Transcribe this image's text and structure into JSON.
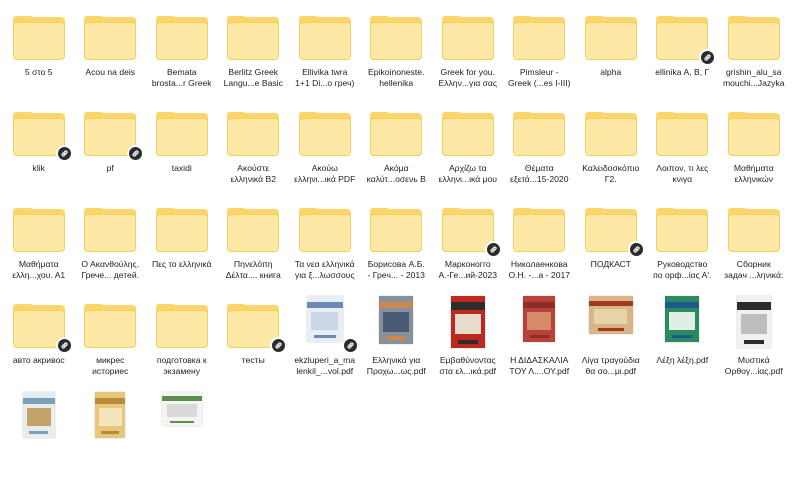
{
  "items": [
    {
      "label": "5 στο 5",
      "kind": "folder",
      "shared": false
    },
    {
      "label": "Acou na deis",
      "kind": "folder",
      "shared": false
    },
    {
      "label": "Bemata\nbrosta...r Greek",
      "kind": "folder",
      "shared": false
    },
    {
      "label": "Berlitz Greek\nLangu...e Basic",
      "kind": "folder",
      "shared": false
    },
    {
      "label": "Ellivika twra\n1+1 Di...o греч)",
      "kind": "folder",
      "shared": false
    },
    {
      "label": "Epikoinoneste.\nhellenika",
      "kind": "folder",
      "shared": false
    },
    {
      "label": "Greek for you.\nΕλλην...για σας",
      "kind": "folder",
      "shared": false
    },
    {
      "label": "Pimsleur -\nGreek (...es I-III)",
      "kind": "folder",
      "shared": false
    },
    {
      "label": "alpha",
      "kind": "folder",
      "shared": false
    },
    {
      "label": "ellinika A, B, Γ",
      "kind": "folder",
      "shared": true
    },
    {
      "label": "grishin_alu_sa\nmouchi...Jazyka",
      "kind": "folder",
      "shared": false
    },
    {
      "label": "klik",
      "kind": "folder",
      "shared": true
    },
    {
      "label": "pf",
      "kind": "folder",
      "shared": true
    },
    {
      "label": "taxidi",
      "kind": "folder",
      "shared": false
    },
    {
      "label": "Ακούστε\nελληνικά Β2",
      "kind": "folder",
      "shared": false
    },
    {
      "label": "Ακούω\nελληνι...ικά PDF",
      "kind": "folder",
      "shared": false
    },
    {
      "label": "Ακόμα\nκαλύτ...οσενь В",
      "kind": "folder",
      "shared": false
    },
    {
      "label": "Αρχίζω τα\nελληνι...ικά μου",
      "kind": "folder",
      "shared": false
    },
    {
      "label": "Θέματα\nεξετά...15-2020",
      "kind": "folder",
      "shared": false
    },
    {
      "label": "Καλειδοσκόπιο\nΓ2.",
      "kind": "folder",
      "shared": false
    },
    {
      "label": "Λοιπον, τι λες\nκνιγα",
      "kind": "folder",
      "shared": false
    },
    {
      "label": "Μαθήματα\nελληνικών",
      "kind": "folder",
      "shared": false
    },
    {
      "label": "Μαθήματα\nελλη...χου. Α1",
      "kind": "folder",
      "shared": false
    },
    {
      "label": "Ο Ακανθούλης.\nГрече... детей.",
      "kind": "folder",
      "shared": false
    },
    {
      "label": "Πες το ελληνικά",
      "kind": "folder",
      "shared": false
    },
    {
      "label": "Πηνελόπη\nΔέλτα.... книга",
      "kind": "folder",
      "shared": false
    },
    {
      "label": "Τα νεα ελληνικά\nγια ξ...λωσσους",
      "kind": "folder",
      "shared": false
    },
    {
      "label": "Борисова А.Б.\n- Грeч... - 2013",
      "kind": "folder",
      "shared": false
    },
    {
      "label": "Марконогго\nА.-Ге...ий-2023",
      "kind": "folder",
      "shared": true
    },
    {
      "label": "Николаенкова\nО.Н. -...а - 2017",
      "kind": "folder",
      "shared": false
    },
    {
      "label": "ПОДКАСТ",
      "kind": "folder",
      "shared": true
    },
    {
      "label": "Руководство\nпо орф...ίας Α'.",
      "kind": "folder",
      "shared": false
    },
    {
      "label": "Сборник\nзадач ...ληνικά:",
      "kind": "folder",
      "shared": false
    },
    {
      "label": "авто акривос",
      "kind": "folder",
      "shared": true
    },
    {
      "label": "микрес\nисториес",
      "kind": "folder",
      "shared": false
    },
    {
      "label": "подготовка к\nэкзамену",
      "kind": "folder",
      "shared": false
    },
    {
      "label": "тесты",
      "kind": "folder",
      "shared": true
    },
    {
      "label": "ekzluperi_a_ma\nlenkil_...vol.pdf",
      "kind": "pdf",
      "shared": true,
      "cover": [
        "#e8eef4",
        "#6d89b5",
        "#c9d6e6"
      ]
    },
    {
      "label": "Ελληνικά για\nΠροχω...ως.pdf",
      "kind": "pdf",
      "shared": false,
      "cover": [
        "#8a8f9c",
        "#c98a52",
        "#4a5a74"
      ]
    },
    {
      "label": "Εμβαθύνοντας\nστα ελ...ικά.pdf",
      "kind": "pdf",
      "shared": false,
      "cover": [
        "#c0271f",
        "#2d2d2d",
        "#e7dccb"
      ]
    },
    {
      "label": "Η ΔΙΔΑΣΚΑΛΙΑ\nΤΟΥ Λ....ΟΥ.pdf",
      "kind": "pdf",
      "shared": false,
      "cover": [
        "#b8413a",
        "#8c2d28",
        "#d68a6a"
      ]
    },
    {
      "label": "Λίγα τραγούδια\nθα σο...μι.pdf",
      "kind": "pdf",
      "shared": false,
      "cover": [
        "#d7b48a",
        "#a3391f",
        "#e8d2a7"
      ]
    },
    {
      "label": "Λέξη λέξη.pdf",
      "kind": "pdf",
      "shared": false,
      "cover": [
        "#2c8a63",
        "#1c5a8c",
        "#e0efe6"
      ]
    },
    {
      "label": "Μυστικά\nΟρθογ...ίας.pdf",
      "kind": "pdf",
      "shared": false,
      "cover": [
        "#f1f1f1",
        "#2b2b2b",
        "#bdbdbd"
      ]
    },
    {
      "label": "",
      "kind": "pdf",
      "shared": false,
      "cover": [
        "#e9ecef",
        "#7aa0b8",
        "#c2a36a"
      ]
    },
    {
      "label": "",
      "kind": "pdf",
      "shared": false,
      "cover": [
        "#e9c77a",
        "#b98a3a",
        "#f3e4bb"
      ]
    },
    {
      "label": "",
      "kind": "pdf",
      "shared": false,
      "cover": [
        "#f4f4f2",
        "#5a8f4e",
        "#d9d9d9"
      ]
    }
  ],
  "icons": {
    "folder": "folder-icon",
    "link": "link-icon",
    "pdf": "pdf-thumbnail"
  },
  "colors": {
    "folder_back": "#fcd66a",
    "folder_front": "#fee8a6",
    "badge": "#2b2b2b"
  }
}
